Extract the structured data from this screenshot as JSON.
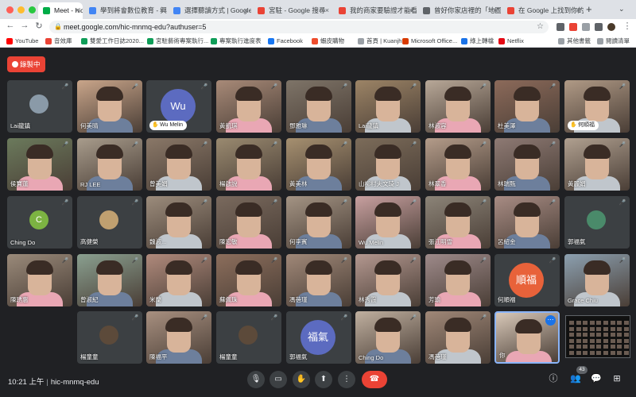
{
  "browser": {
    "tabs": [
      {
        "title": "Meet - hic-mnmq-edu",
        "favicon_color": "#00ac47",
        "active": true
      },
      {
        "title": "學到將會數位教育 - 興",
        "favicon_color": "#4285f4",
        "active": false
      },
      {
        "title": "選擇聽讀方式 | Google",
        "favicon_color": "#4285f4",
        "active": false
      },
      {
        "title": "宮駐 - Google 搜尋",
        "favicon_color": "#ea4335",
        "active": false
      },
      {
        "title": "我的商家要驗證才能看",
        "favicon_color": "#ea4335",
        "active": false
      },
      {
        "title": "曾好你家店裡的「地圖",
        "favicon_color": "#5f6368",
        "active": false
      },
      {
        "title": "在 Google 上找到你的",
        "favicon_color": "#ea4335",
        "active": false
      }
    ],
    "new_tab_label": "+",
    "url": "meet.google.com/hic-mnmq-edu?authuser=5",
    "bookmarks": [
      {
        "label": "YouTube",
        "color": "#ff0000"
      },
      {
        "label": "音效庫",
        "color": "#ea4335"
      },
      {
        "label": "雙愛工作日誌2020...",
        "color": "#0f9d58"
      },
      {
        "label": "宮駐藝術專案執行...",
        "color": "#0f9d58"
      },
      {
        "label": "專案執行進度表",
        "color": "#0f9d58"
      },
      {
        "label": "Facebook",
        "color": "#1877f2"
      },
      {
        "label": "蝦皮購物",
        "color": "#ee4d2d"
      },
      {
        "label": "首頁 | Kuanjhu",
        "color": "#9aa0a6"
      },
      {
        "label": "Microsoft Office...",
        "color": "#d83b01"
      },
      {
        "label": "綠上轉檔",
        "color": "#1a73e8"
      },
      {
        "label": "Netflix",
        "color": "#e50914"
      },
      {
        "label": "其他書籤",
        "color": "#9aa0a6"
      },
      {
        "label": "閱讀清單",
        "color": "#9aa0a6"
      }
    ]
  },
  "meet": {
    "recording_label": "錄製中",
    "participants": [
      {
        "name": "Lai龍鎮",
        "kind": "avatar_photo",
        "color": "#8a9aa8"
      },
      {
        "name": "何美晴",
        "kind": "video",
        "color": "#c9a58a"
      },
      {
        "name": "Wu Melin",
        "kind": "avatar",
        "initials": "Wu",
        "color": "#5c6bc0",
        "hand": true
      },
      {
        "name": "黃凱琪",
        "kind": "video",
        "color": "#a88a78"
      },
      {
        "name": "鄧雅琳",
        "kind": "video",
        "color": "#7e7468"
      },
      {
        "name": "Lai龍鎮",
        "kind": "video",
        "color": "#9c8466"
      },
      {
        "name": "林淑容",
        "kind": "video",
        "color": "#b8a898"
      },
      {
        "name": "杜美澤",
        "kind": "video",
        "color": "#8c6a5a"
      },
      {
        "name": "何順福",
        "kind": "video",
        "color": "#b09a86",
        "hand": true
      },
      {
        "name": "侯寶蓮",
        "kind": "video",
        "color": "#6b7a5c"
      },
      {
        "name": "RJ LEE",
        "kind": "video",
        "color": "#a89c8c"
      },
      {
        "name": "曾美娟",
        "kind": "video",
        "color": "#8a7868"
      },
      {
        "name": "楊啟說",
        "kind": "video",
        "color": "#9a8a70"
      },
      {
        "name": "黃美林",
        "kind": "video",
        "color": "#a69070"
      },
      {
        "name": "山柳村夫文琦 J",
        "kind": "video",
        "color": "#7c6c5a"
      },
      {
        "name": "林翠香",
        "kind": "video",
        "color": "#b49c8a"
      },
      {
        "name": "林瑞甄",
        "kind": "video",
        "color": "#8e7a74"
      },
      {
        "name": "黃麗娟",
        "kind": "video",
        "color": "#b0a090"
      },
      {
        "name": "Ching Do",
        "kind": "avatar",
        "initials": "C",
        "color": "#7cb342"
      },
      {
        "name": "高健榮",
        "kind": "avatar_photo",
        "color": "#c0a070"
      },
      {
        "name": "魏淑...",
        "kind": "video",
        "color": "#9c8c7c"
      },
      {
        "name": "陳宏敏",
        "kind": "video",
        "color": "#7a6a5e"
      },
      {
        "name": "何李賓",
        "kind": "video",
        "color": "#a49484"
      },
      {
        "name": "Wu Melin",
        "kind": "video",
        "color": "#c8a0a0"
      },
      {
        "name": "張江明雪",
        "kind": "video",
        "color": "#8c8478"
      },
      {
        "name": "呂紹金",
        "kind": "video",
        "color": "#a88c84"
      },
      {
        "name": "郭福氣",
        "kind": "avatar_photo",
        "color": "#4a8a6a"
      },
      {
        "name": "陳琇惠",
        "kind": "video",
        "color": "#9a8a7a"
      },
      {
        "name": "曾淑紀",
        "kind": "video",
        "color": "#8aa090"
      },
      {
        "name": "米蘭",
        "kind": "video",
        "color": "#b08a7c"
      },
      {
        "name": "蘇佩珠",
        "kind": "video",
        "color": "#8c6e5c"
      },
      {
        "name": "馮蓓瑾",
        "kind": "video",
        "color": "#a08878"
      },
      {
        "name": "林秀霞",
        "kind": "video",
        "color": "#b49890"
      },
      {
        "name": "芳瑜",
        "kind": "video",
        "color": "#9e8a8a"
      },
      {
        "name": "何順福",
        "kind": "avatar",
        "initials": "順福",
        "color": "#e8623a"
      },
      {
        "name": "Grace Chiu",
        "kind": "video",
        "color": "#8ca0b0"
      },
      {
        "name": "楊童童",
        "kind": "avatar_photo",
        "color": "#5c4a3a"
      },
      {
        "name": "陳福平",
        "kind": "video",
        "color": "#a89080"
      },
      {
        "name": "楊童童",
        "kind": "avatar_photo",
        "color": "#5c4a3a"
      },
      {
        "name": "郭福氣",
        "kind": "avatar",
        "initials": "福氣",
        "color": "#5c6bc0"
      },
      {
        "name": "Ching Do",
        "kind": "video",
        "color": "#c0b0a0"
      },
      {
        "name": "馮蓓瑾",
        "kind": "video",
        "color": "#a08878"
      },
      {
        "name": "你",
        "kind": "self",
        "color": "#d8c8b8"
      }
    ],
    "time": "10:21 上午",
    "meeting_code": "hic-mnmq-edu",
    "participant_count": "43"
  }
}
